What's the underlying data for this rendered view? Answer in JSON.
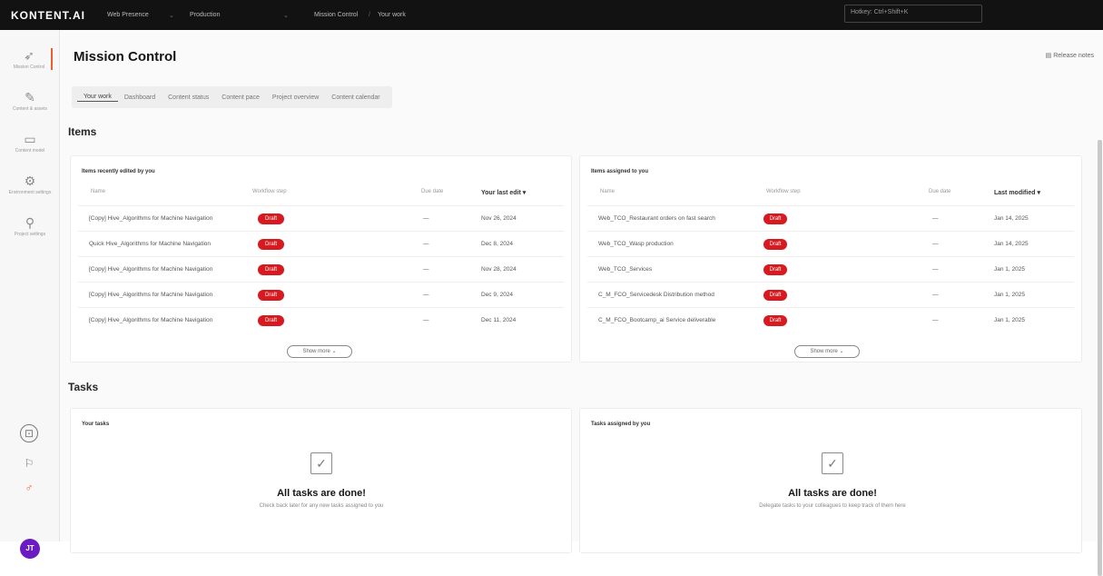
{
  "topbar": {
    "brand": "KONTENT.AI",
    "project": "Web Presence",
    "env": "Production",
    "context": "Mission Control",
    "view": "Your work",
    "search": "Hotkey: Ctrl+Shift+K"
  },
  "nav": [
    {
      "label": "Mission Control",
      "icon": "rocket-icon"
    },
    {
      "label": "Content & assets",
      "icon": "pencil-icon"
    },
    {
      "label": "Content model",
      "icon": "model-icon"
    },
    {
      "label": "Environment settings",
      "icon": "settings-icon"
    },
    {
      "label": "Project settings",
      "icon": "project-icon"
    }
  ],
  "page": {
    "title": "Mission Control",
    "release_notes": "Release notes"
  },
  "tabs": [
    "Your work",
    "Dashboard",
    "Content status",
    "Content pace",
    "Project overview",
    "Content calendar"
  ],
  "items": {
    "title": "Items",
    "recent": {
      "title": "Items recently edited by you",
      "columns": [
        "Name",
        "Workflow step",
        "Due date",
        "Your last edit"
      ],
      "rows": [
        {
          "name": "[Copy] Hive_Algorithms for Machine Navigation",
          "step": "Draft",
          "due": "—",
          "edit": "Nov 26, 2024"
        },
        {
          "name": "Quick Hive_Algorithms for Machine Navigation",
          "step": "Draft",
          "due": "—",
          "edit": "Dec 8, 2024"
        },
        {
          "name": "[Copy] Hive_Algorithms for Machine Navigation",
          "step": "Draft",
          "due": "—",
          "edit": "Nov 28, 2024"
        },
        {
          "name": "[Copy] Hive_Algorithms for Machine Navigation",
          "step": "Draft",
          "due": "—",
          "edit": "Dec 9, 2024"
        },
        {
          "name": "[Copy] Hive_Algorithms for Machine Navigation",
          "step": "Draft",
          "due": "—",
          "edit": "Dec 11, 2024"
        }
      ],
      "more": "Show more"
    },
    "assigned": {
      "title": "Items assigned to you",
      "columns": [
        "Name",
        "Workflow step",
        "Due date",
        "Last modified"
      ],
      "rows": [
        {
          "name": "Web_TCO_Restaurant orders on fast search",
          "step": "Draft",
          "due": "—",
          "mod": "Jan 14, 2025"
        },
        {
          "name": "Web_TCO_Wasp production",
          "step": "Draft",
          "due": "—",
          "mod": "Jan 14, 2025"
        },
        {
          "name": "Web_TCO_Services",
          "step": "Draft",
          "due": "—",
          "mod": "Jan 1, 2025"
        },
        {
          "name": "C_M_FCO_Servicedesk Distribution method",
          "step": "Draft",
          "due": "—",
          "mod": "Jan 1, 2025"
        },
        {
          "name": "C_M_FCO_Bootcamp_ai Service deliverable",
          "step": "Draft",
          "due": "—",
          "mod": "Jan 1, 2025"
        }
      ],
      "more": "Show more"
    }
  },
  "tasks": {
    "title": "Tasks",
    "yours": {
      "title": "Your tasks",
      "done": "All tasks are done!",
      "sub": "Check back later for any new tasks assigned to you"
    },
    "assigned": {
      "title": "Tasks assigned by you",
      "done": "All tasks are done!",
      "sub": "Delegate tasks to your colleagues to keep track of them here"
    }
  },
  "colors": {
    "draft": "#d71920",
    "accent": "#ec5d2f",
    "avatar": "#6a1bc2"
  },
  "avatar": "JT"
}
